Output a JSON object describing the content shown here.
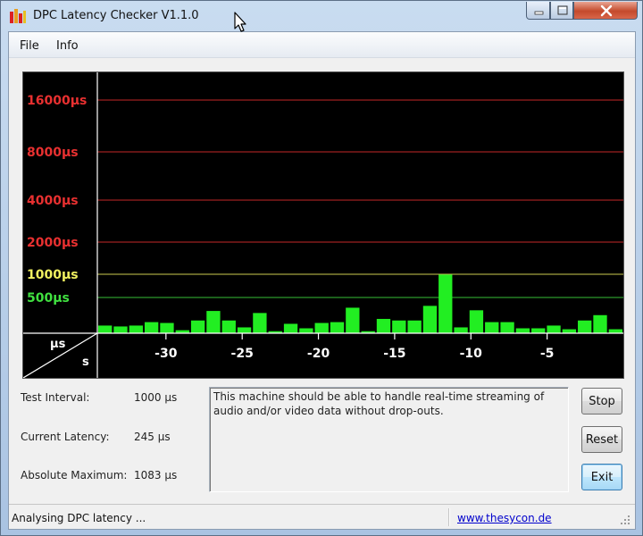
{
  "window": {
    "title": "DPC Latency Checker V1.1.0",
    "icon": "bar-graph-icon",
    "controls": [
      "minimize-icon",
      "maximize-icon",
      "close-icon"
    ]
  },
  "menu": {
    "items": [
      {
        "label": "File"
      },
      {
        "label": "Info"
      }
    ]
  },
  "chart_data": {
    "type": "bar",
    "ylabel": "µs",
    "xlabel": "s",
    "y_scale": "log",
    "y_ticks": [
      {
        "label": "16000µs",
        "value": 16000,
        "color": "#e83030"
      },
      {
        "label": "8000µs",
        "value": 8000,
        "color": "#e83030"
      },
      {
        "label": "4000µs",
        "value": 4000,
        "color": "#e83030"
      },
      {
        "label": "2000µs",
        "value": 2000,
        "color": "#e83030"
      },
      {
        "label": "1000µs",
        "value": 1000,
        "color": "#f0f060"
      },
      {
        "label": "500µs",
        "value": 500,
        "color": "#40e040"
      }
    ],
    "x_ticks": [
      "-30",
      "-25",
      "-20",
      "-15",
      "-10",
      "-5"
    ],
    "x_tick_values": [
      -30,
      -25,
      -20,
      -15,
      -10,
      -5
    ],
    "x_range": [
      -34.5,
      0
    ],
    "bar_color": "#22ee22",
    "values": [
      290,
      285,
      290,
      310,
      305,
      265,
      320,
      385,
      320,
      280,
      370,
      260,
      300,
      275,
      305,
      310,
      410,
      260,
      330,
      320,
      320,
      425,
      990,
      280,
      390,
      310,
      310,
      275,
      275,
      290,
      270,
      320,
      355,
      270
    ]
  },
  "info": {
    "test_interval": {
      "label": "Test Interval:",
      "value": "1000 µs"
    },
    "current_latency": {
      "label": "Current Latency:",
      "value": "245 µs"
    },
    "absolute_maximum": {
      "label": "Absolute Maximum:",
      "value": "1083 µs"
    }
  },
  "message": "This machine should be able to handle real-time streaming of audio and/or video data without drop-outs.",
  "buttons": {
    "stop": "Stop",
    "reset": "Reset",
    "exit": "Exit"
  },
  "status": {
    "text": "Analysing DPC latency ...",
    "link": "www.thesycon.de"
  }
}
